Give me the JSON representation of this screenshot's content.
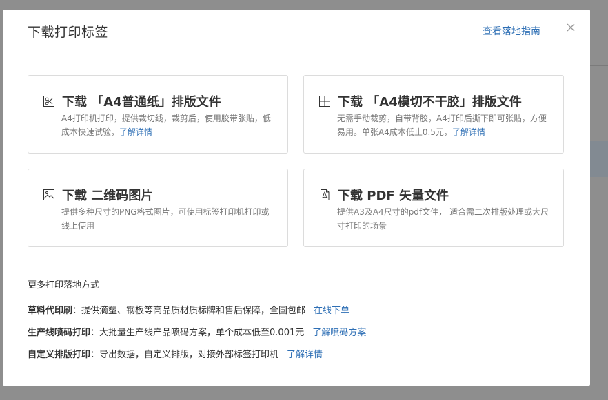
{
  "dialog": {
    "title": "下载打印标签",
    "guide_link": "查看落地指南"
  },
  "cards": [
    {
      "title": "下载 「A4普通纸」排版文件",
      "desc": "A4打印机打印，提供裁切线，裁剪后，使用胶带张贴，低成本快速试验，",
      "link": "了解详情",
      "icon": "scissors-icon"
    },
    {
      "title": "下载 「A4模切不干胶」排版文件",
      "desc": "无需手动裁剪，自带背胶，A4打印后撕下即可张贴，方便易用。单张A4成本低止0.5元，",
      "link": "了解详情",
      "icon": "grid-icon"
    },
    {
      "title": "下载 二维码图片",
      "desc": "提供多种尺寸的PNG格式图片，可使用标签打印机打印或线上使用",
      "icon": "image-icon"
    },
    {
      "title": "下载 PDF 矢量文件",
      "desc": "提供A3及A4尺寸的pdf文件， 适合需二次排版处理或大尺寸打印的场景",
      "icon": "pdf-icon"
    }
  ],
  "more": {
    "title": "更多打印落地方式",
    "rows": [
      {
        "label": "草料代印刷",
        "text": "：提供滴塑、钢板等高品质材质标牌和售后保障，全国包邮",
        "link": "在线下单"
      },
      {
        "label": "生产线喷码打印",
        "text": "：大批量生产线产品喷码方案，单个成本低至0.001元",
        "link": "了解喷码方案"
      },
      {
        "label": "自定义排版打印",
        "text": "：导出数据，自定义排版，对接外部标签打印机",
        "link": "了解详情"
      }
    ]
  }
}
